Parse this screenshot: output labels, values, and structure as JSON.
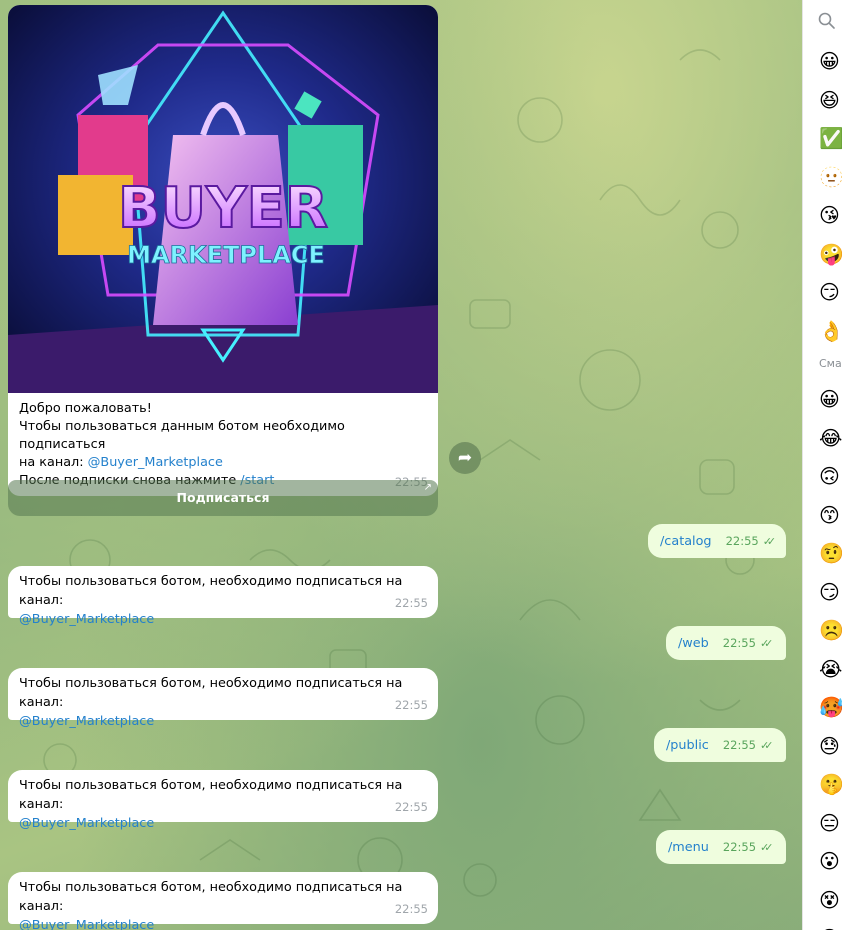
{
  "welcome_post": {
    "image_title": "BUYER",
    "image_subtitle": "MARKETPLACE",
    "line1": "Добро пожаловать!",
    "line2": "Чтобы пользоваться данным ботом необходимо подписаться",
    "line3_prefix": "на канал: ",
    "line3_link": "@Buyer_Marketplace",
    "line4_prefix": "После подписки снова нажмите ",
    "line4_link": "/start",
    "time": "22:55",
    "button_label": "Подписаться",
    "button_arrow": "↗"
  },
  "messages": [
    {
      "direction": "out",
      "text": "/catalog",
      "time": "22:55"
    },
    {
      "direction": "in",
      "text": "Чтобы пользоваться ботом, необходимо подписаться на канал:",
      "link": "@Buyer_Marketplace",
      "time": "22:55"
    },
    {
      "direction": "out",
      "text": "/web",
      "time": "22:55"
    },
    {
      "direction": "in",
      "text": "Чтобы пользоваться ботом, необходимо подписаться на канал:",
      "link": "@Buyer_Marketplace",
      "time": "22:55"
    },
    {
      "direction": "out",
      "text": "/public",
      "time": "22:55"
    },
    {
      "direction": "in",
      "text": "Чтобы пользоваться ботом, необходимо подписаться на канал:",
      "link": "@Buyer_Marketplace",
      "time": "22:55"
    },
    {
      "direction": "out",
      "text": "/menu",
      "time": "22:55"
    },
    {
      "direction": "in",
      "text": "Чтобы пользоваться ботом, необходимо подписаться на канал:",
      "link": "@Buyer_Marketplace",
      "time": "22:55"
    }
  ],
  "read_checks": "✓✓",
  "emoji_panel": {
    "section_label": "Сма",
    "recent": [
      "😀",
      "😆",
      "✅",
      "🫥",
      "😘",
      "🤪",
      "😏",
      "👌"
    ],
    "smileys": [
      "😀",
      "😂",
      "🙃",
      "😙",
      "🤨",
      "😏",
      "☹️",
      "😭",
      "🥵",
      "😓",
      "🤫",
      "😑",
      "😮",
      "😵",
      "😓"
    ]
  },
  "colors": {
    "link": "#2481cc",
    "outgoing_bubble": "#effdde",
    "check": "#5aa55d",
    "time": "#a0a6ab"
  }
}
